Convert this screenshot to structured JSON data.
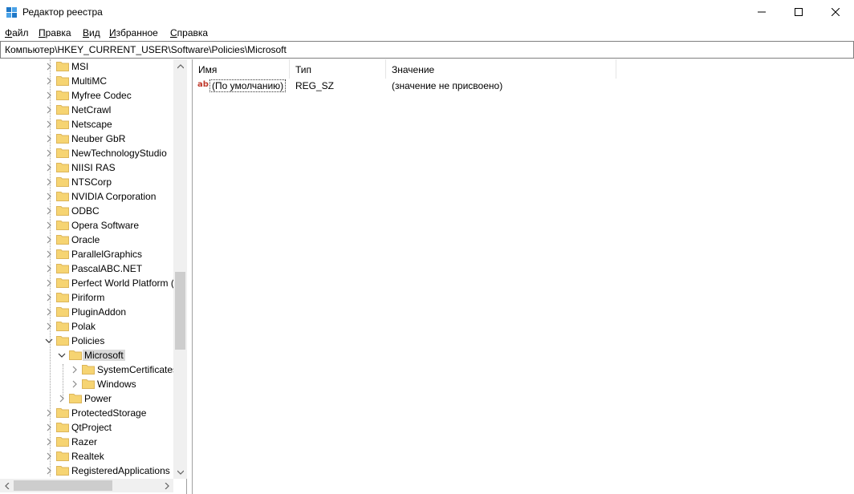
{
  "window": {
    "title": "Редактор реестра",
    "icon": "registry-editor-icon",
    "controls": [
      "minimize-icon",
      "maximize-icon",
      "close-icon"
    ]
  },
  "menu": [
    "Файл",
    "Правка",
    "Вид",
    "Избранное",
    "Справка"
  ],
  "address": "Компьютер\\HKEY_CURRENT_USER\\Software\\Policies\\Microsoft",
  "tree": {
    "items": [
      {
        "label": "MSI",
        "expanded": false
      },
      {
        "label": "MultiMC",
        "expanded": false
      },
      {
        "label": "Myfree Codec",
        "expanded": false
      },
      {
        "label": "NetCrawl",
        "expanded": false
      },
      {
        "label": "Netscape",
        "expanded": false
      },
      {
        "label": "Neuber GbR",
        "expanded": false
      },
      {
        "label": "NewTechnologyStudio",
        "expanded": false
      },
      {
        "label": "NIISI RAS",
        "expanded": false
      },
      {
        "label": "NTSCorp",
        "expanded": false
      },
      {
        "label": "NVIDIA Corporation",
        "expanded": false
      },
      {
        "label": "ODBC",
        "expanded": false
      },
      {
        "label": "Opera Software",
        "expanded": false
      },
      {
        "label": "Oracle",
        "expanded": false
      },
      {
        "label": "ParallelGraphics",
        "expanded": false
      },
      {
        "label": "PascalABC.NET",
        "expanded": false
      },
      {
        "label": "Perfect World Platform (",
        "expanded": false
      },
      {
        "label": "Piriform",
        "expanded": false
      },
      {
        "label": "PluginAddon",
        "expanded": false
      },
      {
        "label": "Polak",
        "expanded": false
      },
      {
        "label": "Policies",
        "expanded": true
      },
      {
        "label": "Microsoft",
        "expanded": true,
        "selected": true
      },
      {
        "label": "SystemCertificates",
        "expanded": false
      },
      {
        "label": "Windows",
        "expanded": false
      },
      {
        "label": "Power",
        "expanded": false
      },
      {
        "label": "ProtectedStorage",
        "expanded": false
      },
      {
        "label": "QtProject",
        "expanded": false
      },
      {
        "label": "Razer",
        "expanded": false
      },
      {
        "label": "Realtek",
        "expanded": false
      },
      {
        "label": "RegisteredApplications",
        "expanded": false
      }
    ]
  },
  "list": {
    "columns": [
      "Имя",
      "Тип",
      "Значение"
    ],
    "rows": [
      {
        "icon": "ab",
        "name": "(По умолчанию)",
        "type": "REG_SZ",
        "value": "(значение не присвоено)"
      }
    ]
  },
  "colors": {
    "folder": "#f6d472",
    "folder_border": "#dcb55a",
    "selection": "#d9d9d9",
    "title_icon": "#1e78c8"
  }
}
